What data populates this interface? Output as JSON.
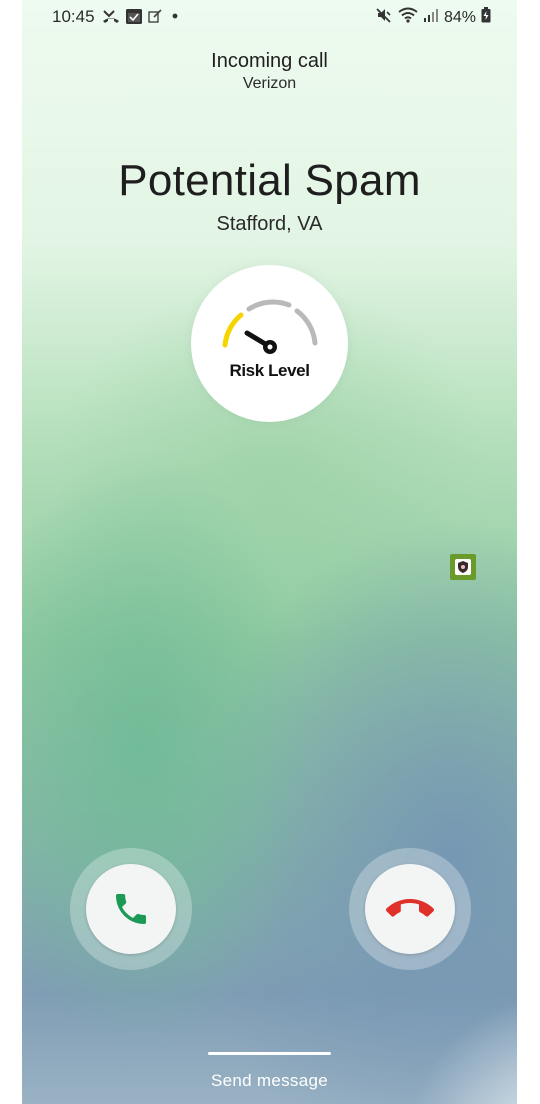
{
  "status_bar": {
    "time": "10:45",
    "battery": "84%",
    "left_icons": [
      "missed-call-icon",
      "calendar-icon",
      "edit-icon",
      "dot-icon"
    ],
    "right_icons": [
      "mute-icon",
      "wifi-icon",
      "signal-icon",
      "battery-icon"
    ]
  },
  "call": {
    "state": "Incoming call",
    "carrier": "Verizon",
    "caller": "Potential Spam",
    "location": "Stafford, VA",
    "risk_label": "Risk Level"
  },
  "actions": {
    "accept_icon": "phone-accept-icon",
    "decline_icon": "phone-decline-icon",
    "send_message": "Send message"
  },
  "colors": {
    "accept": "#1a9a55",
    "decline": "#e0302a",
    "risk_yellow": "#f5d400",
    "risk_gray": "#b9b9b9"
  }
}
